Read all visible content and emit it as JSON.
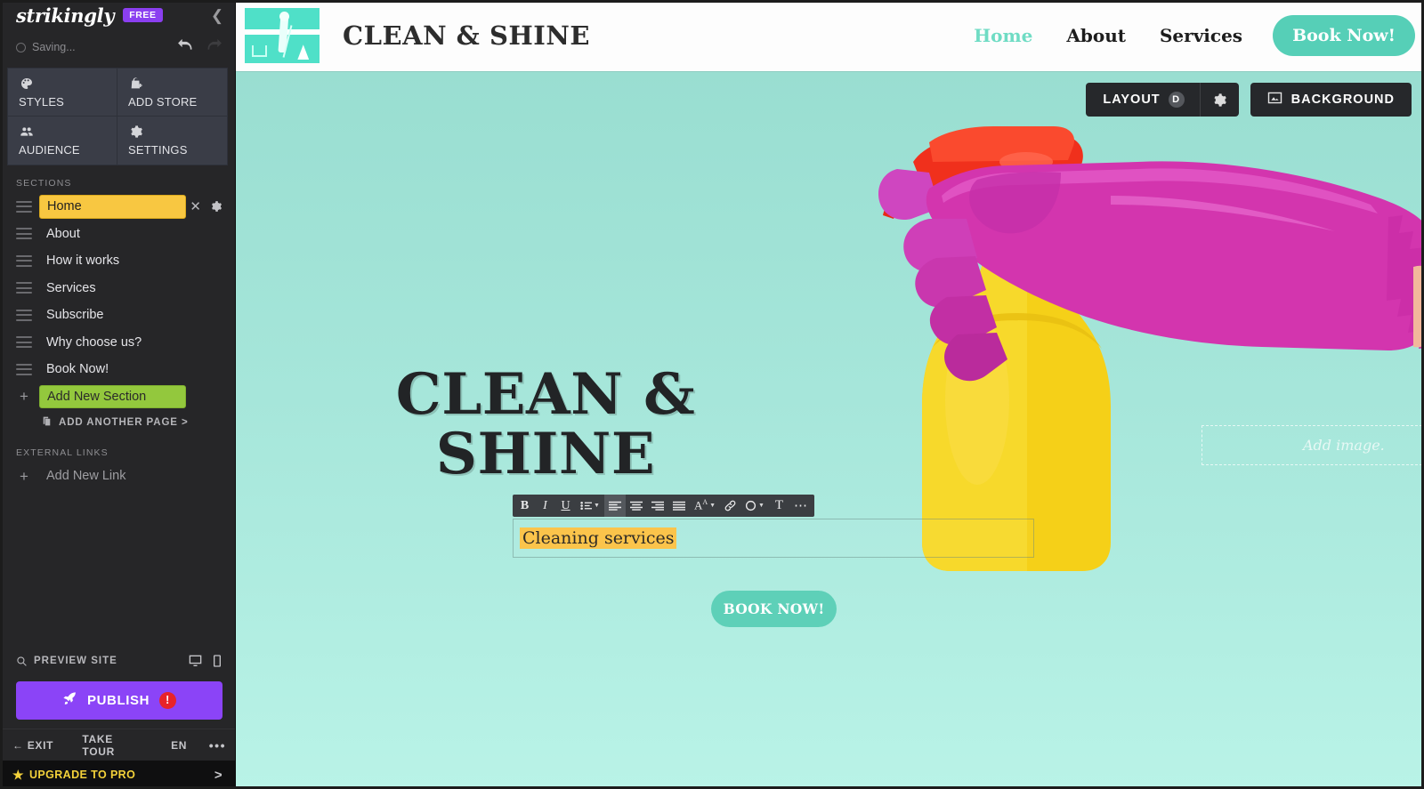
{
  "editor": {
    "brand": "strikingly",
    "plan_badge": "FREE",
    "collapse_icon": "chevron-left-icon",
    "status": "Saving...",
    "undo_icon": "undo-arrow-icon",
    "redo_icon": "redo-arrow-icon",
    "quick_actions": [
      {
        "label": "STYLES",
        "icon": "palette-icon"
      },
      {
        "label": "ADD STORE",
        "icon": "store-bag-plus-icon"
      },
      {
        "label": "AUDIENCE",
        "icon": "people-icon"
      },
      {
        "label": "SETTINGS",
        "icon": "gear-icon"
      }
    ],
    "sections_heading": "SECTIONS",
    "sections": [
      {
        "label": "Home",
        "state": "active"
      },
      {
        "label": "About",
        "state": "normal"
      },
      {
        "label": "How it works",
        "state": "normal"
      },
      {
        "label": "Services",
        "state": "normal"
      },
      {
        "label": "Subscribe",
        "state": "normal"
      },
      {
        "label": "Why choose us?",
        "state": "normal"
      },
      {
        "label": "Book Now!",
        "state": "normal"
      }
    ],
    "add_new_section": "Add New Section",
    "add_another_page": "ADD ANOTHER PAGE >",
    "external_links_heading": "EXTERNAL LINKS",
    "add_new_link": "Add New Link",
    "preview_site": "PREVIEW SITE",
    "desktop_icon": "desktop-monitor-icon",
    "mobile_icon": "mobile-phone-icon",
    "publish": "PUBLISH",
    "publish_warning": "!",
    "footer": {
      "exit": "EXIT",
      "take_tour": "TAKE TOUR",
      "language": "EN",
      "more": "•••"
    },
    "upgrade": "UPGRADE TO PRO",
    "upgrade_chevron": ">",
    "colors": {
      "publish_purple": "#8b44f7",
      "active_section_yellow": "#f8c741",
      "add_section_green": "#93c83d",
      "upgrade_gold": "#f3d13a",
      "warning_red": "#e8232a"
    }
  },
  "canvas_controls": {
    "layout_label": "LAYOUT",
    "layout_shortcut": "D",
    "layout_gear_icon": "gear-icon",
    "background_label": "BACKGROUND",
    "background_icon": "image-icon"
  },
  "site": {
    "logo_alt": "cleaning-service-logo",
    "brand_title": "CLEAN & SHINE",
    "nav": [
      {
        "label": "Home",
        "active": true
      },
      {
        "label": "About",
        "active": false
      },
      {
        "label": "Services",
        "active": false
      }
    ],
    "cta_label": "Book Now!",
    "nav_accent_color": "#6fdcc4",
    "cta_color": "#56cfb7"
  },
  "hero": {
    "title": "CLEAN & SHINE",
    "subtitle_value": "Cleaning services",
    "button_label": "BOOK NOW!",
    "add_image_placeholder": "Add image.",
    "background_top": "#99ded1",
    "background_bottom": "#b9f3e7",
    "artwork": "hand-in-pink-glove-holding-yellow-spray-bottle"
  },
  "rich_text_toolbar": {
    "items": [
      {
        "name": "bold",
        "glyph": "B",
        "active": false
      },
      {
        "name": "italic",
        "glyph": "I",
        "active": false
      },
      {
        "name": "underline",
        "glyph": "U",
        "active": false
      },
      {
        "name": "bullet-list",
        "glyph": "",
        "active": false
      },
      {
        "name": "align-left",
        "glyph": "",
        "active": true
      },
      {
        "name": "align-center",
        "glyph": "",
        "active": false
      },
      {
        "name": "align-right",
        "glyph": "",
        "active": false
      },
      {
        "name": "align-justify",
        "glyph": "",
        "active": false
      },
      {
        "name": "font-size",
        "glyph": "A",
        "active": false
      },
      {
        "name": "link",
        "glyph": "",
        "active": false
      },
      {
        "name": "text-color",
        "glyph": "",
        "active": false
      },
      {
        "name": "text-style",
        "glyph": "T",
        "active": false
      },
      {
        "name": "more-options",
        "glyph": "…",
        "active": false
      }
    ]
  }
}
